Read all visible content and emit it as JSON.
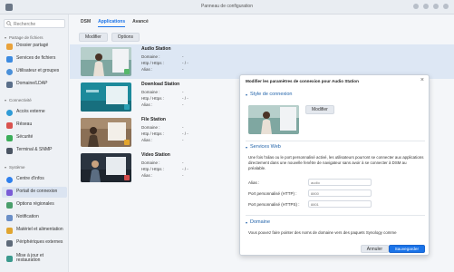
{
  "window": {
    "title": "Panneau de configuration"
  },
  "search": {
    "placeholder": "Recherche"
  },
  "sidebar": {
    "sections": [
      {
        "label": "Partage de fichiers"
      },
      {
        "label": "Connectivité"
      },
      {
        "label": "Système"
      }
    ],
    "items": [
      {
        "label": "Dossier partagé",
        "icon": "folder-icon",
        "color": "#e9a23b"
      },
      {
        "label": "Services de fichiers",
        "icon": "file-services-icon",
        "color": "#3d8be0"
      },
      {
        "label": "Utilisateur et groupes",
        "icon": "users-icon",
        "color": "#4a90d9"
      },
      {
        "label": "Domaine/LDAP",
        "icon": "domain-icon",
        "color": "#5a6f8a"
      },
      {
        "label": "Accès externe",
        "icon": "globe-icon",
        "color": "#2f9bd6"
      },
      {
        "label": "Réseau",
        "icon": "network-icon",
        "color": "#d9534f"
      },
      {
        "label": "Sécurité",
        "icon": "shield-icon",
        "color": "#3cae5a"
      },
      {
        "label": "Terminal & SNMP",
        "icon": "terminal-icon",
        "color": "#4b5563"
      },
      {
        "label": "Centre d'infos",
        "icon": "info-icon",
        "color": "#2f80ed"
      },
      {
        "label": "Portail de connexion",
        "icon": "portal-icon",
        "color": "#7a5cd6"
      },
      {
        "label": "Options régionales",
        "icon": "region-icon",
        "color": "#4a9e6b"
      },
      {
        "label": "Notification",
        "icon": "notification-icon",
        "color": "#6b8fc7"
      },
      {
        "label": "Matériel et alimentation",
        "icon": "power-icon",
        "color": "#e0a530"
      },
      {
        "label": "Périphériques externes",
        "icon": "external-device-icon",
        "color": "#5f6b7a"
      },
      {
        "label": "Mise à jour et restauration",
        "icon": "update-icon",
        "color": "#3b9a8e"
      }
    ]
  },
  "tabs": [
    {
      "label": "DSM"
    },
    {
      "label": "Applications"
    },
    {
      "label": "Avancé"
    }
  ],
  "toolbar": {
    "edit_label": "Modifier",
    "options_label": "Options"
  },
  "apps": [
    {
      "name": "Audio Station",
      "domain_label": "Domaine :",
      "domain_value": "-",
      "http_label": "Http / Https :",
      "http_value": "- / -",
      "alias_label": "Alias :",
      "alias_value": "-"
    },
    {
      "name": "Download Station",
      "domain_label": "Domaine :",
      "domain_value": "-",
      "http_label": "Http / Https :",
      "http_value": "- / -",
      "alias_label": "Alias :",
      "alias_value": "-"
    },
    {
      "name": "File Station",
      "domain_label": "Domaine :",
      "domain_value": "-",
      "http_label": "Http / Https :",
      "http_value": "- / -",
      "alias_label": "Alias :",
      "alias_value": "-"
    },
    {
      "name": "Video Station",
      "domain_label": "Domaine :",
      "domain_value": "-",
      "http_label": "Http / Https :",
      "http_value": "- / -",
      "alias_label": "Alias :",
      "alias_value": "-"
    }
  ],
  "dialog": {
    "title": "Modifier les paramètres de connexion pour Audio Station",
    "section_style": "Style de connexion",
    "modify_label": "Modifier",
    "section_web": "Services Web",
    "web_text": "Une fois l'alias ou le port personnalisé activé, les utilisateurs pourront se connecter aux applications directement dans une nouvelle fenêtre de navigateur sans avoir à se connecter à DSM au préalable.",
    "alias_label": "Alias :",
    "alias_placeholder": "audio",
    "http_label": "Port personnalisé (HTTP) :",
    "http_placeholder": "8800",
    "https_label": "Port personnalisé (HTTPS) :",
    "https_placeholder": "8801",
    "section_domain": "Domaine",
    "domain_text": "Vous pouvez faire pointer des noms de domaine vers des paquets Synology comme",
    "cancel_label": "Annuler",
    "save_label": "Sauvegarder"
  },
  "colors": {
    "accent": "#1a73e8",
    "section": "#2364aa",
    "selected_row": "#dde7f4"
  }
}
